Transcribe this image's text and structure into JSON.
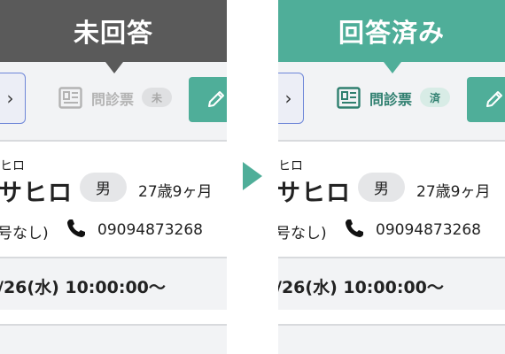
{
  "colors": {
    "unanswered_header": "#5a5a5a",
    "answered_header": "#4fae99",
    "accent": "#4fae99",
    "muted_text": "#b3b3b3",
    "answered_text": "#2f7f6f",
    "badge_unanswered_bg": "#dfe0e2",
    "badge_answered_bg": "#d8ece6"
  },
  "before": {
    "header": "未回答",
    "nav_chevron": "›",
    "questionnaire_icon": "document-list-icon",
    "questionnaire_label": "問診票",
    "badge": "未",
    "edit_icon": "pencil-icon",
    "patient": {
      "furigana": "ヒロ",
      "name": "サヒロ",
      "gender": "男",
      "age": "27歳9ヶ月",
      "card_no": "号なし)",
      "phone_icon": "phone-icon",
      "phone": "09094873268"
    },
    "appointment": "/26(水) 10:00:00〜"
  },
  "after": {
    "header": "回答済み",
    "nav_chevron": "›",
    "questionnaire_icon": "document-list-icon",
    "questionnaire_label": "問診票",
    "badge": "済",
    "edit_icon": "pencil-icon",
    "patient": {
      "furigana": "ヒロ",
      "name": "サヒロ",
      "gender": "男",
      "age": "27歳9ヶ月",
      "card_no": "号なし)",
      "phone_icon": "phone-icon",
      "phone": "09094873268"
    },
    "appointment": "/26(水) 10:00:00〜"
  },
  "transition_icon": "arrow-right-icon"
}
